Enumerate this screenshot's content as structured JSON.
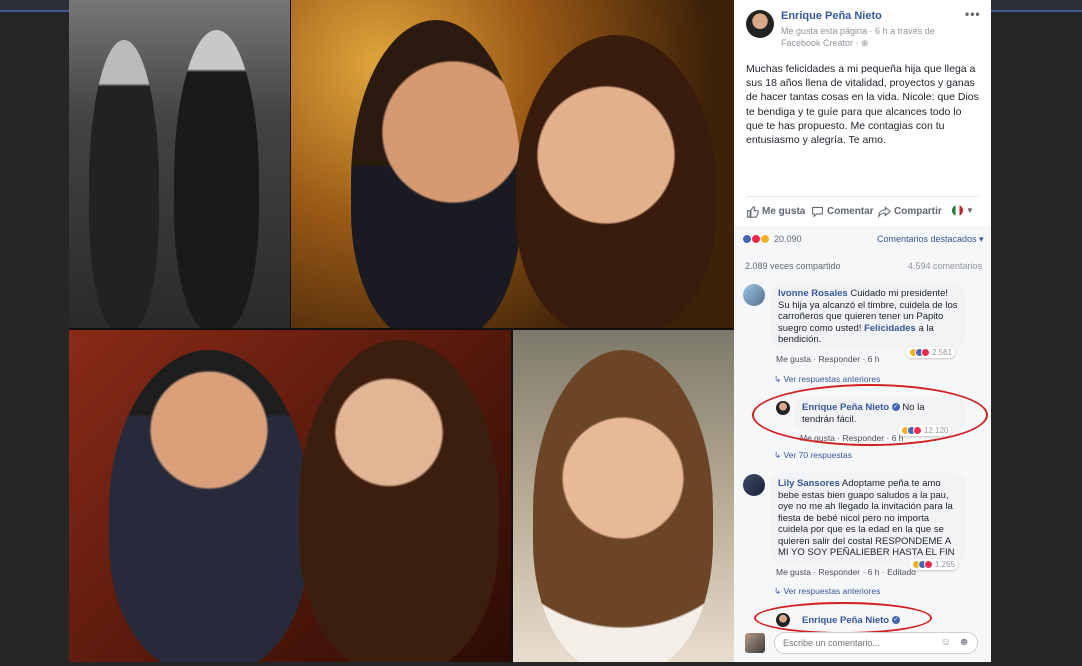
{
  "post": {
    "page_name": "Enrique Peña Nieto",
    "meta": "Me gusta esta página · 6 h a través de Facebook Creator · ",
    "text": "Muchas felicidades a mi pequeña hija que llega a sus 18 años llena de vitalidad, proyectos y ganas de hacer tantas cosas en la vida. Nicole: que Dios te bendiga y te guíe para que alcances todo lo que te has propuesto. Me contagias con tu entusiasmo y alegría. Te amo.",
    "menu_icon": "ellipsis-icon"
  },
  "actions": {
    "like": "Me gusta",
    "comment": "Comentar",
    "share": "Compartir"
  },
  "stats": {
    "reactions": "20.090",
    "sort_label": "Comentarios destacados ▾",
    "shares": "2.089 veces compartido",
    "comments": "4.594 comentarios"
  },
  "comments": [
    {
      "author": "Ivonne Rosales",
      "text_before": " Cuidado mi presidente! Su hija ya alcanzó el timbre, cuidela de los carroñeros que quieren tener un Papito suegro como usted! ",
      "highlight": "Felicidades",
      "text_after": " a la bendición.",
      "like": "Me gusta",
      "reply": "Responder",
      "time": "6 h",
      "reactions": "2.561",
      "more_replies": "Ver respuestas anteriores",
      "reply_item": {
        "author": "Enrique Peña Nieto",
        "text": " No la tendrán fácil.",
        "like": "Me gusta",
        "reply": "Responder",
        "time": "6 h",
        "reactions": "12.120",
        "replies_label": "Ver 70 respuestas"
      }
    },
    {
      "author": "Lily Sansores",
      "text": " Adoptame peña te amo bebe estas bien guapo saludos a la pau, oye no me ah llegado la invitación para la fiesta de bebé nicol pero no importa cuidela por que es la edad en la que se quieren salir del costal RESPONDEME A MI YO SOY PEÑALIEBER HASTA EL FIN",
      "like": "Me gusta",
      "reply": "Responder",
      "time": "6 h",
      "edited": "Editado",
      "reactions": "1.265",
      "more_replies": "Ver respuestas anteriores",
      "reply_item": {
        "author": "Enrique Peña Nieto"
      }
    }
  ],
  "composer": {
    "placeholder": "Escribe un comentario..."
  },
  "colors": {
    "link": "#365899",
    "oval": "#d21f1f",
    "panel_bg": "#f6f7f9"
  }
}
